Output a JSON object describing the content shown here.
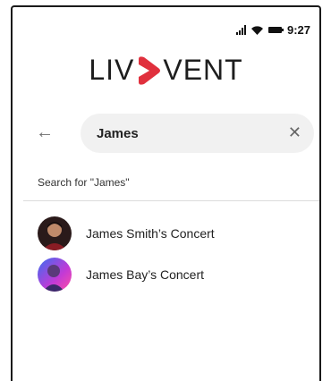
{
  "status": {
    "time": "9:27"
  },
  "logo": {
    "left": "LIV",
    "right": "VENT"
  },
  "search": {
    "value": "James"
  },
  "suggestion": "Search for \"James\"",
  "results": [
    {
      "label": "James Smith’s Concert"
    },
    {
      "label": "James Bay’s Concert"
    }
  ],
  "colors": {
    "brand": "#e0303d"
  }
}
